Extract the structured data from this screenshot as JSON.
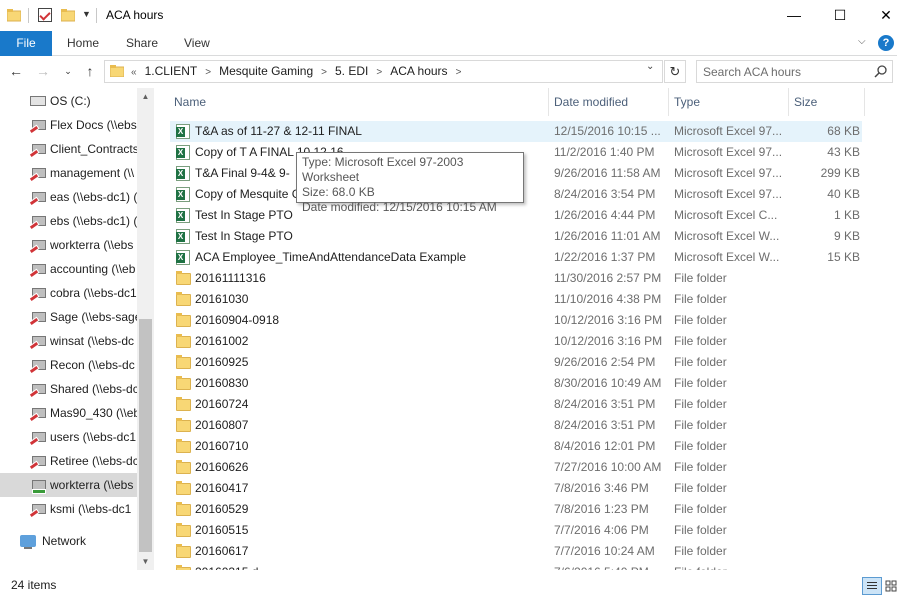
{
  "window": {
    "title": "ACA hours",
    "minimize_glyph": "—",
    "maximize_glyph": "☐",
    "close_glyph": "✕"
  },
  "ribbon": {
    "tabs": [
      "File",
      "Home",
      "Share",
      "View"
    ]
  },
  "address": {
    "overflow": "«",
    "crumbs": [
      "1.CLIENT",
      "Mesquite Gaming",
      "5. EDI",
      "ACA hours"
    ]
  },
  "search": {
    "placeholder": "Search ACA hours"
  },
  "navpane": {
    "items": [
      {
        "label": "OS (C:)",
        "icon": "drive-icon",
        "status": "local"
      },
      {
        "label": "Flex Docs (\\\\ebs-",
        "icon": "network-drive-icon",
        "status": "disconnected"
      },
      {
        "label": "Client_Contracts",
        "icon": "network-drive-icon",
        "status": "disconnected"
      },
      {
        "label": "management (\\\\",
        "icon": "network-drive-icon",
        "status": "disconnected"
      },
      {
        "label": "eas (\\\\ebs-dc1) (",
        "icon": "network-drive-icon",
        "status": "disconnected"
      },
      {
        "label": "ebs (\\\\ebs-dc1) (",
        "icon": "network-drive-icon",
        "status": "disconnected"
      },
      {
        "label": "workterra (\\\\ebs",
        "icon": "network-drive-icon",
        "status": "disconnected"
      },
      {
        "label": "accounting (\\\\eb",
        "icon": "network-drive-icon",
        "status": "disconnected"
      },
      {
        "label": "cobra (\\\\ebs-dc1",
        "icon": "network-drive-icon",
        "status": "disconnected"
      },
      {
        "label": "Sage (\\\\ebs-sage",
        "icon": "network-drive-icon",
        "status": "disconnected"
      },
      {
        "label": "winsat (\\\\ebs-dc",
        "icon": "network-drive-icon",
        "status": "disconnected"
      },
      {
        "label": "Recon (\\\\ebs-dc",
        "icon": "network-drive-icon",
        "status": "disconnected"
      },
      {
        "label": "Shared (\\\\ebs-dc",
        "icon": "network-drive-icon",
        "status": "disconnected"
      },
      {
        "label": "Mas90_430 (\\\\eb",
        "icon": "network-drive-icon",
        "status": "disconnected"
      },
      {
        "label": "users (\\\\ebs-dc1",
        "icon": "network-drive-icon",
        "status": "disconnected"
      },
      {
        "label": "Retiree (\\\\ebs-dc",
        "icon": "network-drive-icon",
        "status": "disconnected"
      },
      {
        "label": "workterra (\\\\ebs",
        "icon": "network-drive-icon",
        "status": "connected",
        "selected": true
      },
      {
        "label": "ksmi (\\\\ebs-dc1",
        "icon": "network-drive-icon",
        "status": "disconnected"
      }
    ],
    "network_label": "Network"
  },
  "columns": {
    "name": "Name",
    "date": "Date modified",
    "type": "Type",
    "size": "Size"
  },
  "files": [
    {
      "name": "T&A  as of 11-27 & 12-11 FINAL",
      "date": "12/15/2016 10:15 ...",
      "type": "Microsoft Excel 97...",
      "size": "68 KB",
      "icon": "excel-icon",
      "hover": true
    },
    {
      "name": "Copy of T  A FINAL 10 12 16",
      "date": "11/2/2016 1:40 PM",
      "type": "Microsoft Excel 97...",
      "size": "43 KB",
      "icon": "excel-icon"
    },
    {
      "name": "T&A Final  9-4& 9-",
      "date": "9/26/2016 11:58 AM",
      "type": "Microsoft Excel 97...",
      "size": "299 KB",
      "icon": "excel-icon"
    },
    {
      "name": "Copy of Mesquite G",
      "date": "8/24/2016 3:54 PM",
      "type": "Microsoft Excel 97...",
      "size": "40 KB",
      "icon": "excel-icon"
    },
    {
      "name": "Test In Stage PTO",
      "date": "1/26/2016 4:44 PM",
      "type": "Microsoft Excel C...",
      "size": "1 KB",
      "icon": "excel-csv-icon"
    },
    {
      "name": "Test In Stage PTO",
      "date": "1/26/2016 11:01 AM",
      "type": "Microsoft Excel W...",
      "size": "9 KB",
      "icon": "excel-icon"
    },
    {
      "name": "ACA Employee_TimeAndAttendanceData Example",
      "date": "1/22/2016 1:37 PM",
      "type": "Microsoft Excel W...",
      "size": "15 KB",
      "icon": "excel-icon"
    },
    {
      "name": "20161111316",
      "date": "11/30/2016 2:57 PM",
      "type": "File folder",
      "size": "",
      "icon": "folder-icon"
    },
    {
      "name": "20161030",
      "date": "11/10/2016 4:38 PM",
      "type": "File folder",
      "size": "",
      "icon": "folder-icon"
    },
    {
      "name": "20160904-0918",
      "date": "10/12/2016 3:16 PM",
      "type": "File folder",
      "size": "",
      "icon": "folder-icon"
    },
    {
      "name": "20161002",
      "date": "10/12/2016 3:16 PM",
      "type": "File folder",
      "size": "",
      "icon": "folder-icon"
    },
    {
      "name": "20160925",
      "date": "9/26/2016 2:54 PM",
      "type": "File folder",
      "size": "",
      "icon": "folder-icon"
    },
    {
      "name": "20160830",
      "date": "8/30/2016 10:49 AM",
      "type": "File folder",
      "size": "",
      "icon": "folder-icon"
    },
    {
      "name": "20160724",
      "date": "8/24/2016 3:51 PM",
      "type": "File folder",
      "size": "",
      "icon": "folder-icon"
    },
    {
      "name": "20160807",
      "date": "8/24/2016 3:51 PM",
      "type": "File folder",
      "size": "",
      "icon": "folder-icon"
    },
    {
      "name": "20160710",
      "date": "8/4/2016 12:01 PM",
      "type": "File folder",
      "size": "",
      "icon": "folder-icon"
    },
    {
      "name": "20160626",
      "date": "7/27/2016 10:00 AM",
      "type": "File folder",
      "size": "",
      "icon": "folder-icon"
    },
    {
      "name": "20160417",
      "date": "7/8/2016 3:46 PM",
      "type": "File folder",
      "size": "",
      "icon": "folder-icon"
    },
    {
      "name": "20160529",
      "date": "7/8/2016 1:23 PM",
      "type": "File folder",
      "size": "",
      "icon": "folder-icon"
    },
    {
      "name": "20160515",
      "date": "7/7/2016 4:06 PM",
      "type": "File folder",
      "size": "",
      "icon": "folder-icon"
    },
    {
      "name": "20160617",
      "date": "7/7/2016 10:24 AM",
      "type": "File folder",
      "size": "",
      "icon": "folder-icon"
    },
    {
      "name": "20160315 d",
      "date": "7/6/2016 5:40 PM",
      "type": "File folder",
      "size": "",
      "icon": "folder-icon"
    }
  ],
  "tooltip": {
    "type": "Type: Microsoft Excel 97-2003 Worksheet",
    "size": "Size: 68.0 KB",
    "date": "Date modified: 12/15/2016 10:15 AM"
  },
  "status": {
    "count": "24 items"
  },
  "colors": {
    "file_tab": "#1979ca",
    "hover_row": "#e5f3fb",
    "selected_nav": "#d9d9d9",
    "excel_green": "#1f7244",
    "folder_yellow": "#f8d775",
    "disconnected_red": "#d13438"
  }
}
